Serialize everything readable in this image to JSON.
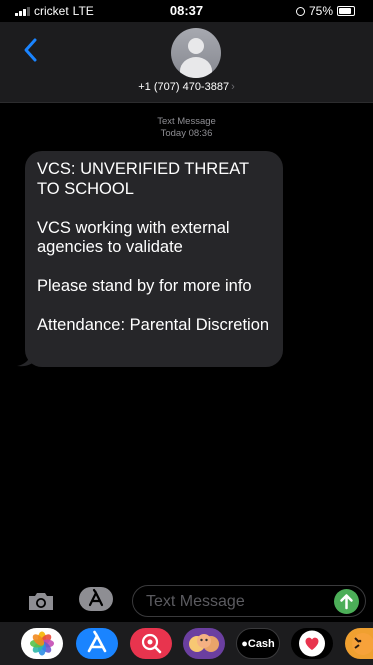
{
  "status_bar": {
    "carrier": "cricket",
    "network": "LTE",
    "time": "08:37",
    "battery": "75%"
  },
  "header": {
    "contact_number": "+1 (707) 470-3887",
    "chevron": "›"
  },
  "thread": {
    "service_label": "Text Message",
    "timestamp": "Today 08:36",
    "message": {
      "paragraphs": [
        "VCS: UNVERIFIED THREAT TO SCHOOL",
        "VCS working with external agencies to validate",
        "Please stand by for more info",
        "Attendance: Parental Discretion"
      ]
    }
  },
  "input_bar": {
    "placeholder": "Text Message"
  },
  "app_drawer": {
    "apps": [
      {
        "name": "Photos",
        "icon": "photos-icon"
      },
      {
        "name": "App Store",
        "icon": "app-store-icon"
      },
      {
        "name": "Images Search",
        "icon": "image-search-icon"
      },
      {
        "name": "Memoji",
        "icon": "memoji-icon"
      },
      {
        "name": "Apple Cash",
        "icon": "apple-cash-icon",
        "label": "Cash"
      },
      {
        "name": "Digital Touch",
        "icon": "digital-touch-icon"
      },
      {
        "name": "Animoji",
        "icon": "animoji-icon"
      }
    ]
  },
  "colors": {
    "background": "#000000",
    "header": "#1c1c1e",
    "received_bubble": "#262629",
    "accent_blue": "#1a84ff",
    "send_green": "#4cae58",
    "meta_gray": "#8e8e93"
  }
}
